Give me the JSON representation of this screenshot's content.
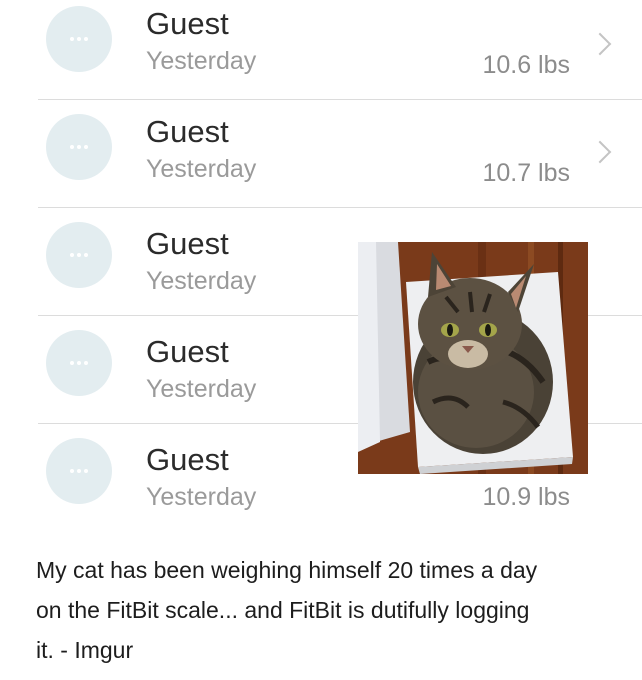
{
  "entries": [
    {
      "name": "Guest",
      "date": "Yesterday",
      "weight": "10.6 lbs"
    },
    {
      "name": "Guest",
      "date": "Yesterday",
      "weight": "10.7 lbs"
    },
    {
      "name": "Guest",
      "date": "Yesterday",
      "weight": ""
    },
    {
      "name": "Guest",
      "date": "Yesterday",
      "weight": ""
    },
    {
      "name": "Guest",
      "date": "Yesterday",
      "weight": "10.9 lbs"
    }
  ],
  "icons": {
    "avatar": "guest-avatar-dots-icon",
    "chevron": "chevron-right-icon"
  },
  "colors": {
    "avatar_bg": "#e3edf0",
    "name_text": "#2b2b2b",
    "secondary_text": "#9a9a9a"
  },
  "caption": {
    "line1": "My cat has been weighing himself 20 times a day",
    "line2": "on the FitBit scale... and FitBit is dutifully logging",
    "line3": "it. - Imgur"
  }
}
